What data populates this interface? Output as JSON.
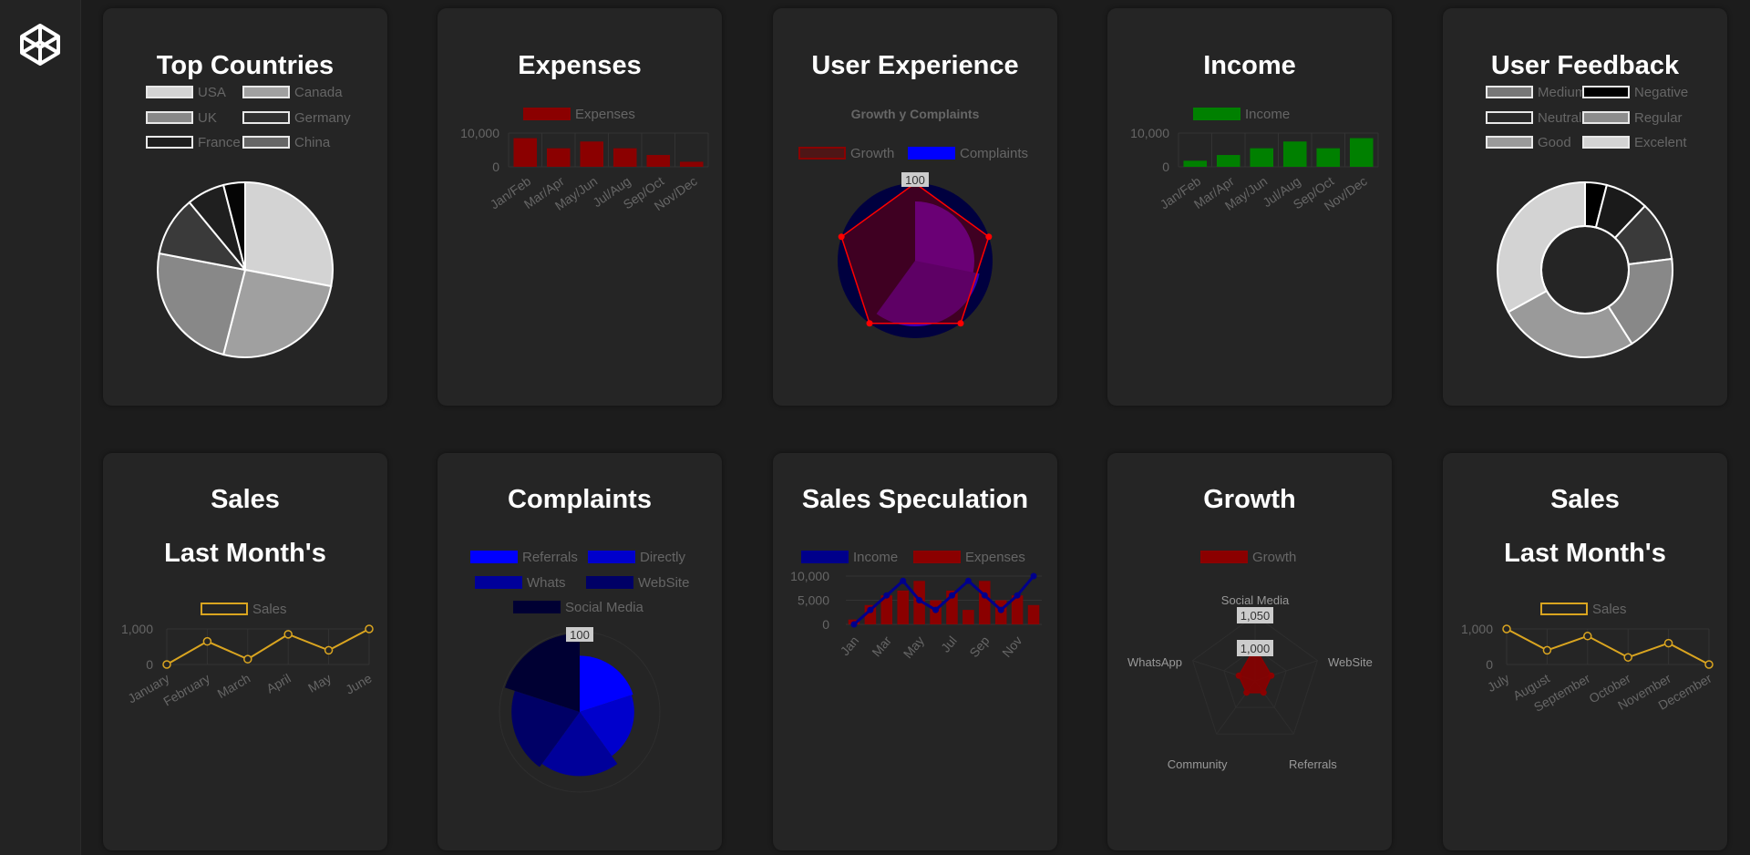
{
  "colors": {
    "background": "#1c1c1c",
    "card": "#252525",
    "sidebar": "#232323",
    "title": "#ffffff",
    "muted_text": "#666666",
    "grid": "#333333"
  },
  "sidebar": {
    "logo_icon": "codepen-cube-icon"
  },
  "cards": [
    {
      "title_lines": [
        "Top Countries"
      ],
      "chart_data": {
        "type": "pie",
        "categories": [
          "USA",
          "Canada",
          "UK",
          "Germany",
          "France",
          "China"
        ],
        "values": [
          28,
          26,
          24,
          11,
          7,
          4
        ],
        "legend_colors": [
          "#d3d3d3",
          "#a0a0a0",
          "#888888",
          "#303030",
          "#1f1f1f",
          "#666666"
        ],
        "slice_colors": [
          "#d3d3d3",
          "#a0a0a0",
          "#888888",
          "#3a3a3a",
          "#1f1f1f",
          "#050505"
        ],
        "legend_position": "top"
      }
    },
    {
      "title_lines": [
        "Expenses"
      ],
      "chart_data": {
        "type": "bar",
        "categories": [
          "Jan/Feb",
          "Mar/Apr",
          "May/Jun",
          "Jul/Aug",
          "Sep/Oct",
          "Nov/Dec"
        ],
        "series": [
          {
            "name": "Expenses",
            "values": [
              8500,
              5500,
              7500,
              5500,
              3500,
              1500
            ],
            "color": "#8b0000"
          }
        ],
        "y_ticks": [
          "10,000",
          "0"
        ],
        "ylim": [
          0,
          10000
        ],
        "grid": true,
        "legend_position": "top"
      }
    },
    {
      "title_lines": [
        "User Experience"
      ],
      "chart_data": {
        "type": "radar",
        "title": "Growth y Complaints",
        "tick_label": "100",
        "series": [
          {
            "name": "Growth",
            "color": "#8b0000"
          },
          {
            "name": "Complaints",
            "color": "#0000ff"
          }
        ],
        "legend_position": "top"
      }
    },
    {
      "title_lines": [
        "Income"
      ],
      "chart_data": {
        "type": "bar",
        "categories": [
          "Jan/Feb",
          "Mar/Apr",
          "May/Jun",
          "Jul/Aug",
          "Sep/Oct",
          "Nov/Dec"
        ],
        "series": [
          {
            "name": "Income",
            "values": [
              1800,
              3500,
              5500,
              7500,
              5500,
              8500
            ],
            "color": "#008000"
          }
        ],
        "y_ticks": [
          "10,000",
          "0"
        ],
        "ylim": [
          0,
          10000
        ],
        "grid": true,
        "legend_position": "top"
      }
    },
    {
      "title_lines": [
        "User Feedback"
      ],
      "chart_data": {
        "type": "doughnut",
        "categories": [
          "Medium",
          "Negative",
          "Neutral",
          "Regular",
          "Good",
          "Excelent"
        ],
        "values": [
          4,
          8,
          11,
          18,
          26,
          33
        ],
        "legend_colors": [
          "#777777",
          "#000000",
          "#2a2a2a",
          "#8c8c8c",
          "#9a9a9a",
          "#d3d3d3"
        ],
        "slice_colors": [
          "#000000",
          "#1a1a1a",
          "#3a3a3a",
          "#888888",
          "#9a9a9a",
          "#d3d3d3"
        ],
        "legend_position": "top"
      }
    },
    {
      "title_lines": [
        "Sales",
        "Last Month's"
      ],
      "chart_data": {
        "type": "line",
        "categories": [
          "January",
          "February",
          "March",
          "April",
          "May",
          "June"
        ],
        "series": [
          {
            "name": "Sales",
            "values": [
              0,
              650,
              150,
              850,
              400,
              1000
            ],
            "color": "#daa520"
          }
        ],
        "y_ticks": [
          "1,000",
          "0"
        ],
        "ylim": [
          0,
          1000
        ],
        "grid": true,
        "legend_position": "top"
      }
    },
    {
      "title_lines": [
        "Complaints"
      ],
      "chart_data": {
        "type": "polarArea",
        "categories": [
          "Referrals",
          "Directly",
          "Whats",
          "WebSite",
          "Social Media"
        ],
        "values": [
          70,
          68,
          80,
          85,
          98
        ],
        "colors": [
          "#0000ff",
          "#0000cc",
          "#00009a",
          "#000066",
          "#000033"
        ],
        "tick_label": "100",
        "rmax": 100,
        "legend_position": "top"
      }
    },
    {
      "title_lines": [
        "Sales Speculation"
      ],
      "chart_data": {
        "type": "bar+line",
        "categories": [
          "Jan",
          "Feb",
          "Mar",
          "Apr",
          "May",
          "Jun",
          "Jul",
          "Aug",
          "Sep",
          "Oct",
          "Nov",
          "Dec"
        ],
        "x_tick_labels": [
          "Jan",
          "Mar",
          "May",
          "Jul",
          "Sep",
          "Nov"
        ],
        "series": [
          {
            "name": "Income",
            "type": "line",
            "values": [
              0,
              3000,
              6000,
              9000,
              5000,
              3000,
              6000,
              9000,
              6000,
              3000,
              6000,
              10000
            ],
            "color": "#00008b"
          },
          {
            "name": "Expenses",
            "type": "bar",
            "values": [
              1000,
              4000,
              6000,
              7000,
              9000,
              5000,
              7000,
              3000,
              9000,
              5000,
              6000,
              4000
            ],
            "color": "#8b0000"
          }
        ],
        "y_ticks": [
          "10,000",
          "5,000",
          "0"
        ],
        "ylim": [
          0,
          10000
        ],
        "grid": true,
        "legend_position": "top"
      }
    },
    {
      "title_lines": [
        "Growth"
      ],
      "chart_data": {
        "type": "radar",
        "categories": [
          "Social Media",
          "WebSite",
          "Referrals",
          "Community",
          "WhatsApp"
        ],
        "series": [
          {
            "name": "Growth",
            "values": [
              1051,
              1026,
              1022,
              1022,
              1026
            ],
            "color": "#8b0000"
          }
        ],
        "tick_labels": [
          "1,050",
          "1,000"
        ],
        "rmin": 1000,
        "rmax": 1100,
        "legend_position": "top"
      }
    },
    {
      "title_lines": [
        "Sales",
        "Last Month's"
      ],
      "chart_data": {
        "type": "line",
        "categories": [
          "July",
          "August",
          "September",
          "October",
          "November",
          "December"
        ],
        "series": [
          {
            "name": "Sales",
            "values": [
              1000,
              400,
              800,
              200,
              600,
              0
            ],
            "color": "#daa520"
          }
        ],
        "y_ticks": [
          "1,000",
          "0"
        ],
        "ylim": [
          0,
          1000
        ],
        "grid": true,
        "legend_position": "top"
      }
    }
  ]
}
